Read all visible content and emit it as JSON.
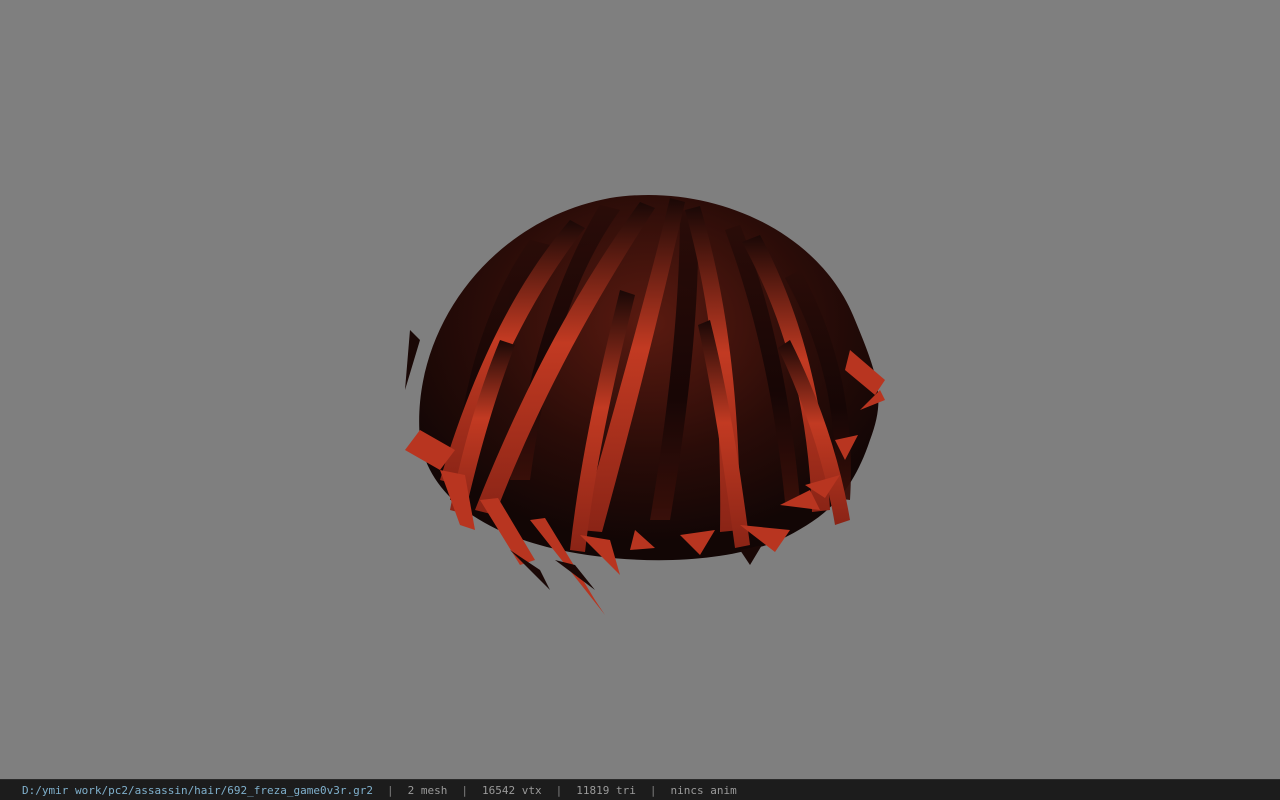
{
  "viewport": {
    "background_color": "#7f7f7f",
    "model": {
      "name": "hair-mesh",
      "hair_color_light": "#c23a22",
      "hair_color_dark": "#1a0a08"
    }
  },
  "status": {
    "file_path": "D:/ymir work/pc2/assassin/hair/692_freza_game0v3r.gr2",
    "separator": "|",
    "mesh_count": "2 mesh",
    "vertex_count": "16542 vtx",
    "triangle_count": "11819 tri",
    "anim_status": "nincs anim",
    "path_color": "#7fb0cc",
    "text_color": "#9a9a9a"
  }
}
